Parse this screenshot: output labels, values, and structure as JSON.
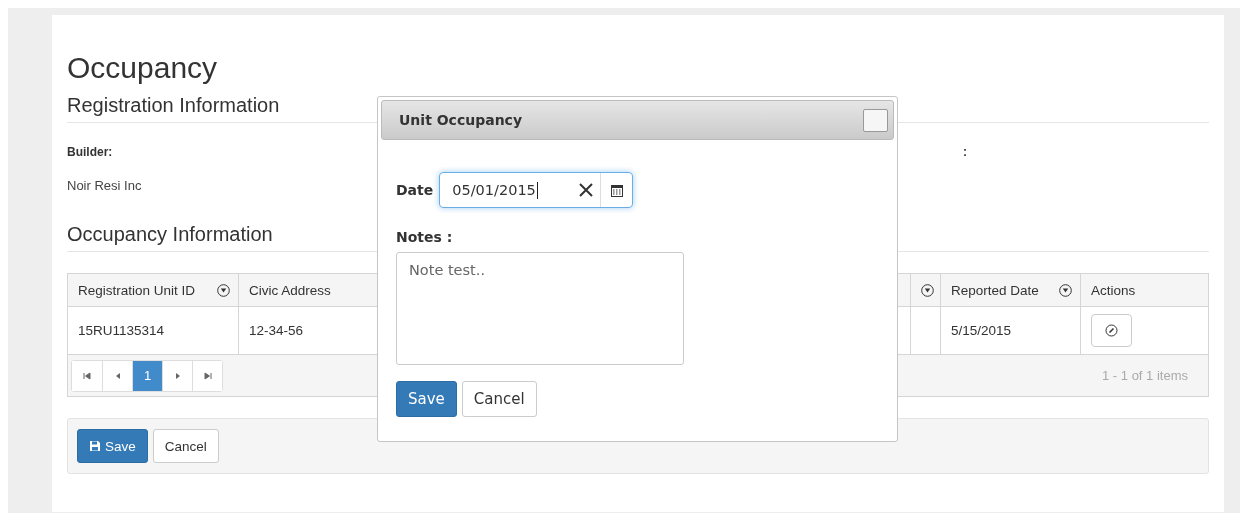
{
  "page": {
    "title": "Occupancy"
  },
  "registration": {
    "heading": "Registration Information",
    "fields": [
      {
        "label": "Builder:",
        "value": "Noir Resi Inc"
      },
      {
        "label": ":"
      }
    ]
  },
  "occupancy": {
    "heading": "Occupancy Information",
    "table": {
      "columns": [
        {
          "label": "Registration Unit ID",
          "filter": true
        },
        {
          "label": "Civic Address",
          "filter": false
        },
        {
          "filter": true
        },
        {
          "label": "Reported Date",
          "filter": true
        },
        {
          "label": "Actions",
          "filter": false
        }
      ],
      "rows": [
        {
          "cells": [
            "15RU1135314",
            "12-34-56",
            "",
            "5/15/2015"
          ]
        }
      ]
    },
    "pager": {
      "pages": [
        {
          "label": "1",
          "selected": true
        }
      ],
      "summary": "1 - 1 of 1 items"
    }
  },
  "footer_buttons": [
    {
      "label": "Save",
      "kind": "primary"
    },
    {
      "label": "Cancel",
      "kind": "default"
    }
  ],
  "dialog": {
    "title": "Unit Occupancy",
    "date_label": "Date",
    "date_value": "05/01/2015",
    "notes_label": "Notes :",
    "notes_value": "Note test..",
    "buttons": [
      {
        "label": "Save",
        "kind": "primary"
      },
      {
        "label": "Cancel",
        "kind": "default"
      }
    ]
  }
}
